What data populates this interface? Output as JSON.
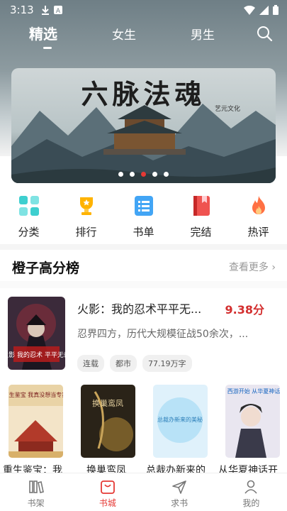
{
  "status_bar": {
    "time": "3:13"
  },
  "top_tabs": [
    {
      "label": "精选",
      "active": true
    },
    {
      "label": "女生",
      "active": false
    },
    {
      "label": "男生",
      "active": false
    }
  ],
  "banner": {
    "title": "六脉法魂",
    "subtitle": "艺元文化",
    "dots_count": 5,
    "active_dot": 2
  },
  "categories": [
    {
      "label": "分类",
      "icon": "grid-icon",
      "color": "#3ecfcf"
    },
    {
      "label": "排行",
      "icon": "trophy-icon",
      "color": "#ffb300"
    },
    {
      "label": "书单",
      "icon": "list-icon",
      "color": "#42a5f5"
    },
    {
      "label": "完结",
      "icon": "book-icon",
      "color": "#ef5350"
    },
    {
      "label": "热评",
      "icon": "flame-icon",
      "color": "#ff7043"
    }
  ],
  "section": {
    "title": "橙子高分榜",
    "more": "查看更多"
  },
  "featured_book": {
    "title": "火影：我的忍术平平无...",
    "score": "9.38分",
    "description": "忍界四方，历代大规模征战50余次，...",
    "tags": [
      "连载",
      "都市",
      "77.19万字"
    ],
    "cover_text": "火影 我的忍术 平平无奇"
  },
  "books": [
    {
      "title": "重生鉴宝：我...",
      "cover_text": "重生鉴宝 我真没想当专家"
    },
    {
      "title": "换巢鸾凤",
      "cover_text": "换巢鸾凤"
    },
    {
      "title": "总裁办新来的...",
      "cover_text": "总裁办新来的美秘"
    },
    {
      "title": "从华夏神话开...",
      "cover_text": "西游开始 从华夏神话"
    }
  ],
  "bottom_nav": [
    {
      "label": "书架",
      "icon": "bookshelf-icon",
      "active": false
    },
    {
      "label": "书城",
      "icon": "store-icon",
      "active": true
    },
    {
      "label": "求书",
      "icon": "send-icon",
      "active": false
    },
    {
      "label": "我的",
      "icon": "user-icon",
      "active": false
    }
  ],
  "colors": {
    "accent": "#e53935",
    "score": "#d32f2f"
  }
}
